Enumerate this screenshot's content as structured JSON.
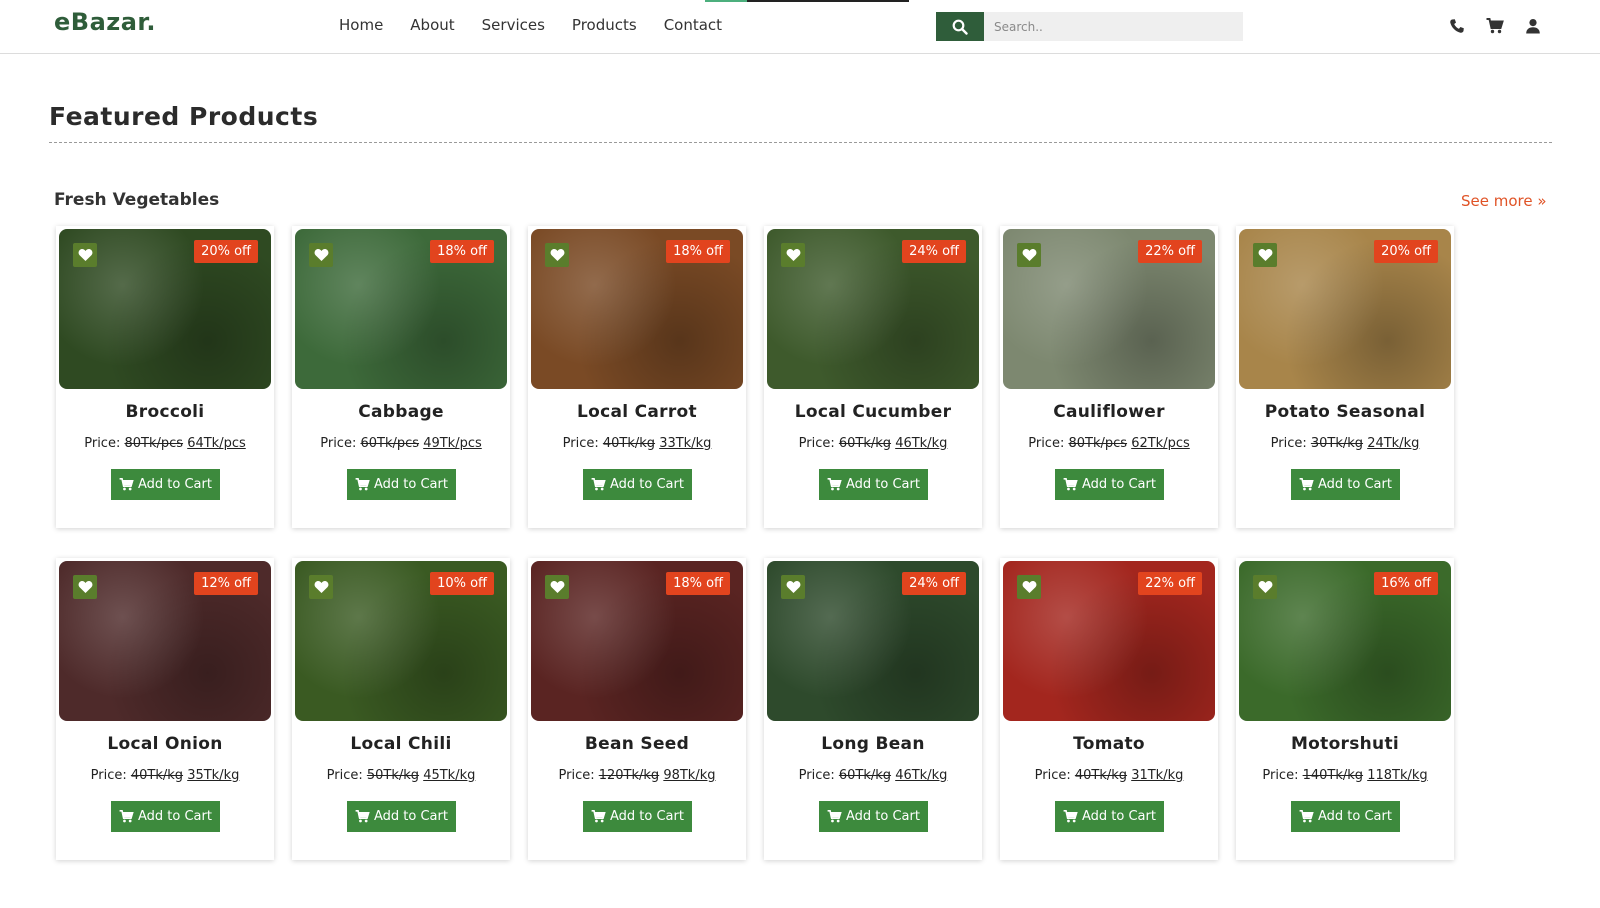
{
  "brand": {
    "logo": "eBazar."
  },
  "nav": {
    "items": [
      "Home",
      "About",
      "Services",
      "Products",
      "Contact"
    ]
  },
  "search": {
    "placeholder": "Search.."
  },
  "header_icons": [
    "phone-icon",
    "cart-icon",
    "user-icon"
  ],
  "page": {
    "title": "Featured Products"
  },
  "category": {
    "title": "Fresh Vegetables",
    "see_more": "See more »"
  },
  "labels": {
    "price": "Price:",
    "add_to_cart": "Add to Cart"
  },
  "colors": {
    "brand_green": "#2f5d3a",
    "button_green": "#3d8a3d",
    "badge_red": "#e2441e",
    "fav_green": "#5a7d2c",
    "link_orange": "#e05326"
  },
  "products": [
    {
      "name": "Broccoli",
      "discount": "20% off",
      "old_price": "80Tk/pcs",
      "new_price": "64Tk/pcs",
      "color": "#2f4a22"
    },
    {
      "name": "Cabbage",
      "discount": "18% off",
      "old_price": "60Tk/pcs",
      "new_price": "49Tk/pcs",
      "color": "#3d6a3a"
    },
    {
      "name": "Local Carrot",
      "discount": "18% off",
      "old_price": "40Tk/kg",
      "new_price": "33Tk/kg",
      "color": "#7a4a25"
    },
    {
      "name": "Local Cucumber",
      "discount": "24% off",
      "old_price": "60Tk/kg",
      "new_price": "46Tk/kg",
      "color": "#3e5a2c"
    },
    {
      "name": "Cauliflower",
      "discount": "22% off",
      "old_price": "80Tk/pcs",
      "new_price": "62Tk/pcs",
      "color": "#7d8870"
    },
    {
      "name": "Potato Seasonal",
      "discount": "20% off",
      "old_price": "30Tk/kg",
      "new_price": "24Tk/kg",
      "color": "#a8854a"
    },
    {
      "name": "Local Onion",
      "discount": "12% off",
      "old_price": "40Tk/kg",
      "new_price": "35Tk/kg",
      "color": "#4e2a2a"
    },
    {
      "name": "Local Chili",
      "discount": "10% off",
      "old_price": "50Tk/kg",
      "new_price": "45Tk/kg",
      "color": "#3a5a22"
    },
    {
      "name": "Bean Seed",
      "discount": "18% off",
      "old_price": "120Tk/kg",
      "new_price": "98Tk/kg",
      "color": "#5a2422"
    },
    {
      "name": "Long Bean",
      "discount": "24% off",
      "old_price": "60Tk/kg",
      "new_price": "46Tk/kg",
      "color": "#2e4a2c"
    },
    {
      "name": "Tomato",
      "discount": "22% off",
      "old_price": "40Tk/kg",
      "new_price": "31Tk/kg",
      "color": "#a3261e"
    },
    {
      "name": "Motorshuti",
      "discount": "16% off",
      "old_price": "140Tk/kg",
      "new_price": "118Tk/kg",
      "color": "#3b6a2a"
    }
  ]
}
